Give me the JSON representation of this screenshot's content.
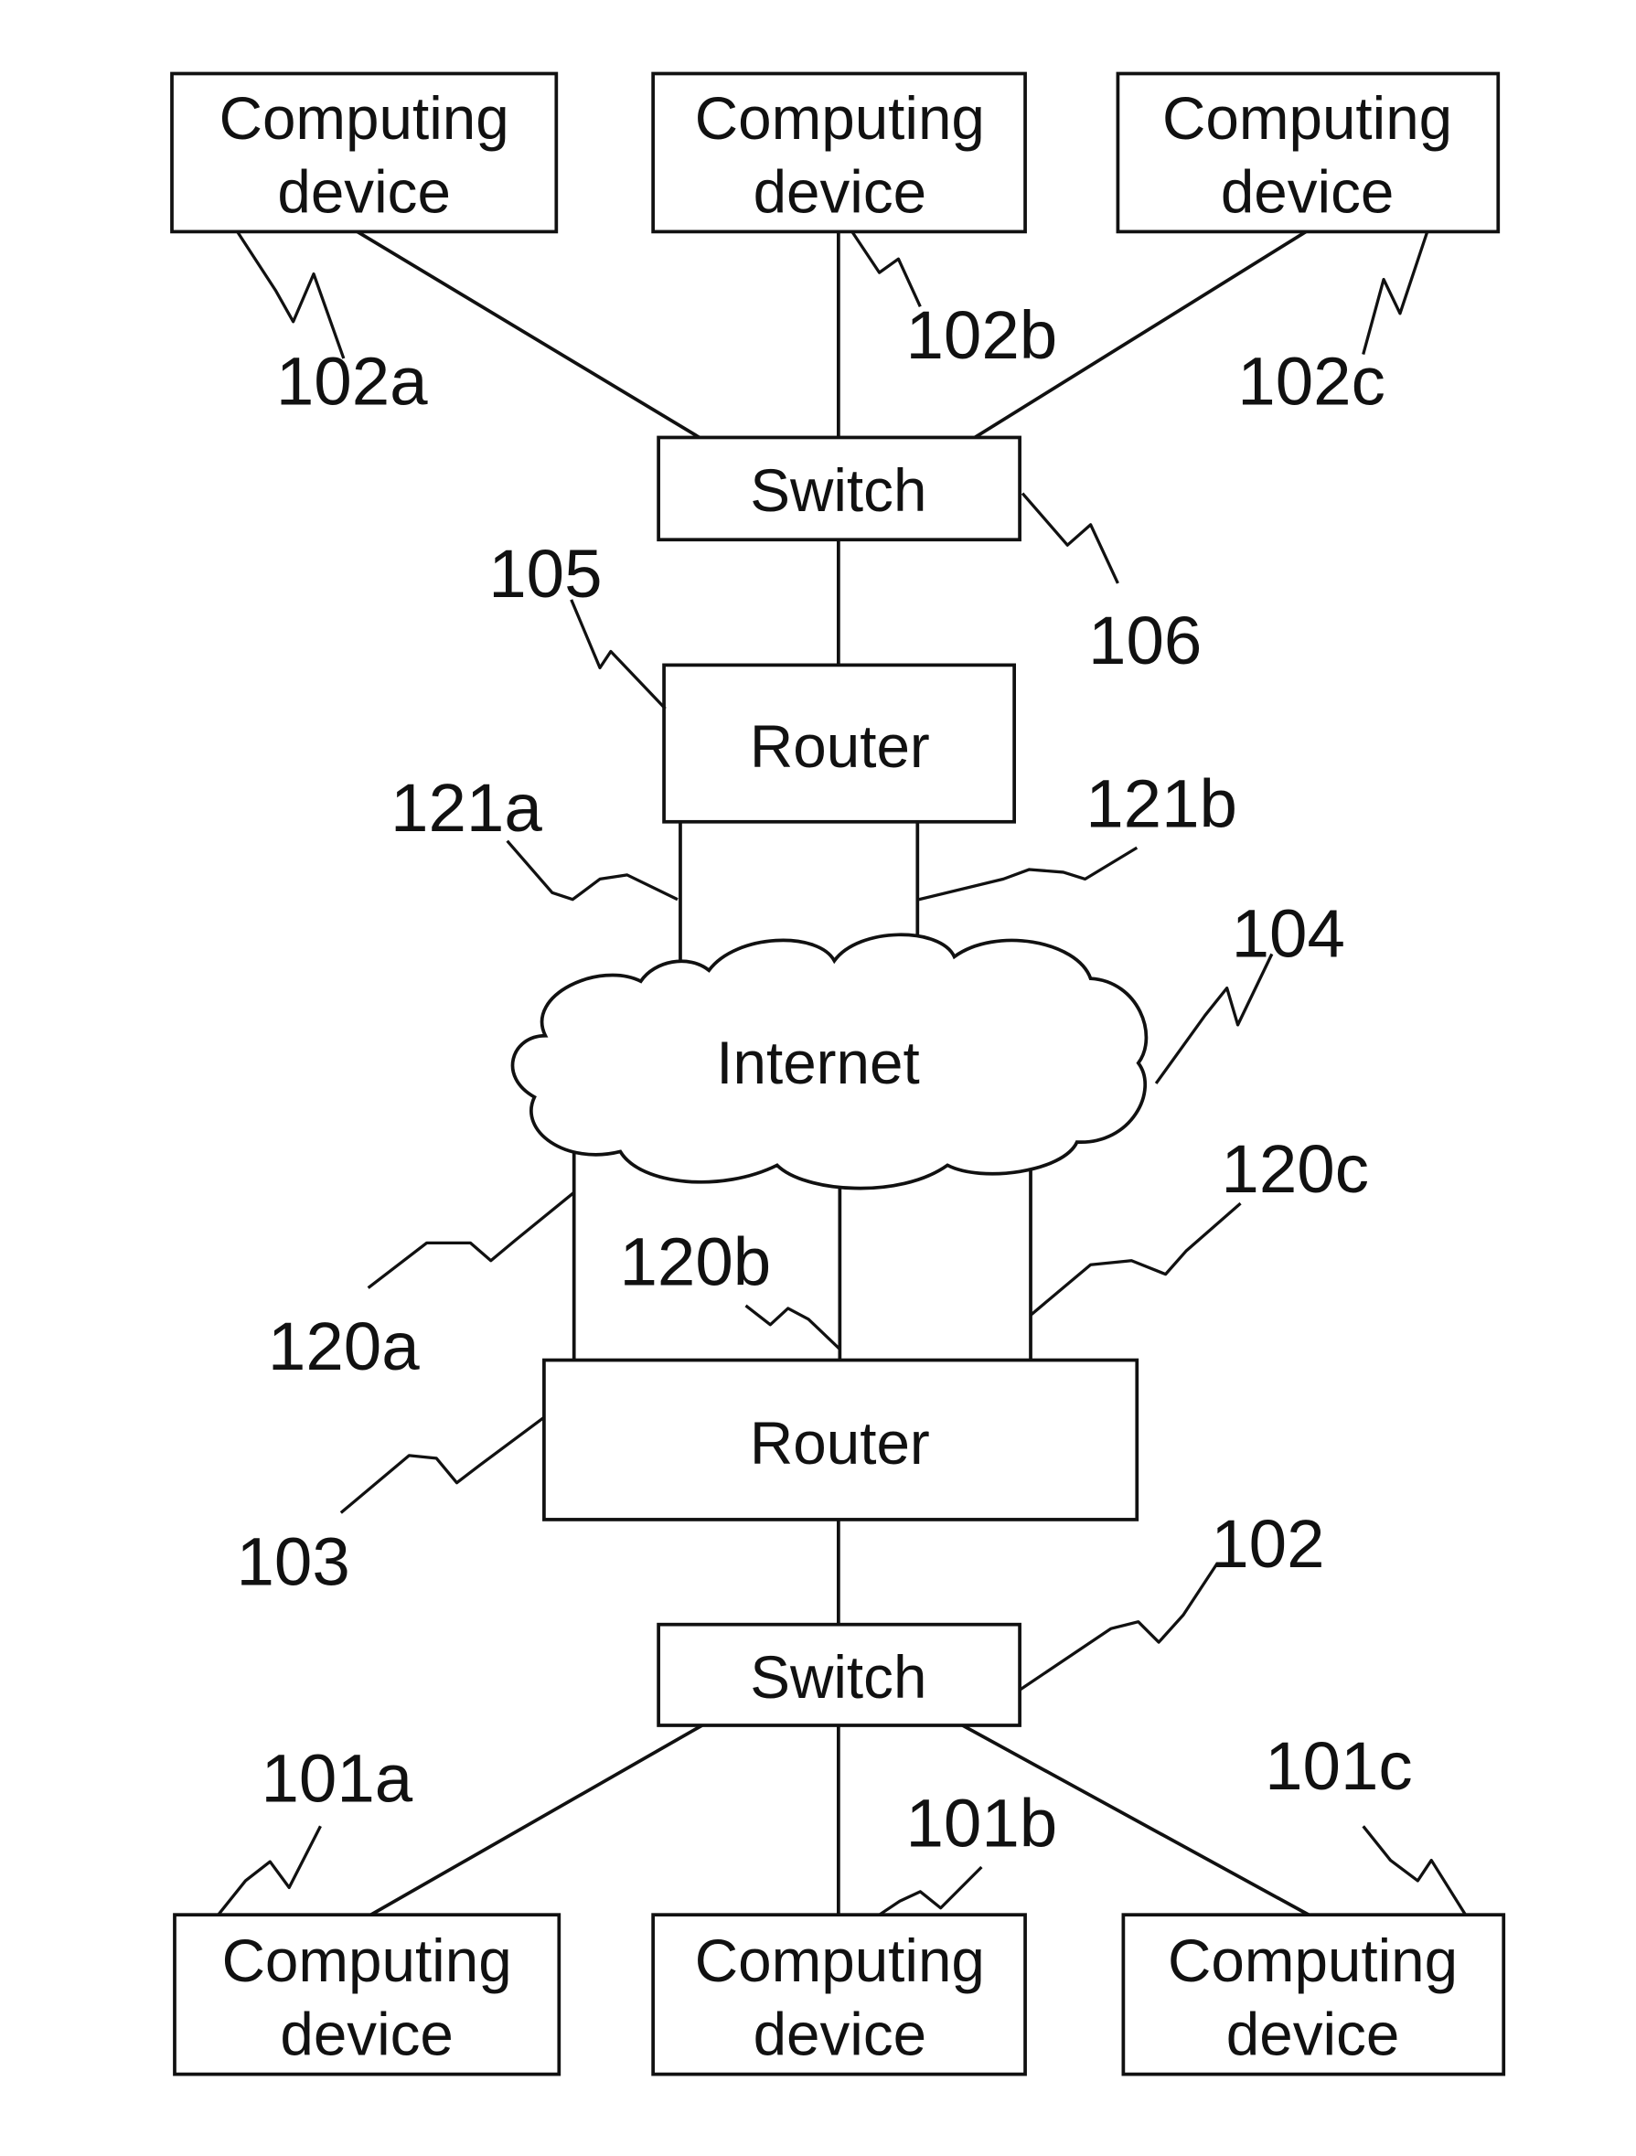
{
  "diagram": {
    "type": "network-topology",
    "nodes": {
      "top_devices": [
        {
          "line1": "Computing",
          "line2": "device",
          "ref": "102a"
        },
        {
          "line1": "Computing",
          "line2": "device",
          "ref": "102b"
        },
        {
          "line1": "Computing",
          "line2": "device",
          "ref": "102c"
        }
      ],
      "top_switch": {
        "label": "Switch",
        "ref": "106"
      },
      "top_router": {
        "label": "Router",
        "ref": "105"
      },
      "internet": {
        "label": "Internet",
        "ref": "104"
      },
      "bottom_router": {
        "label": "Router",
        "ref": "103"
      },
      "bottom_switch": {
        "label": "Switch",
        "ref": "102"
      },
      "bottom_devices": [
        {
          "line1": "Computing",
          "line2": "device",
          "ref": "101a"
        },
        {
          "line1": "Computing",
          "line2": "device",
          "ref": "101b"
        },
        {
          "line1": "Computing",
          "line2": "device",
          "ref": "101c"
        }
      ]
    },
    "links": {
      "top_router_to_internet": [
        "121a",
        "121b"
      ],
      "internet_to_bottom_router": [
        "120a",
        "120b",
        "120c"
      ]
    }
  }
}
